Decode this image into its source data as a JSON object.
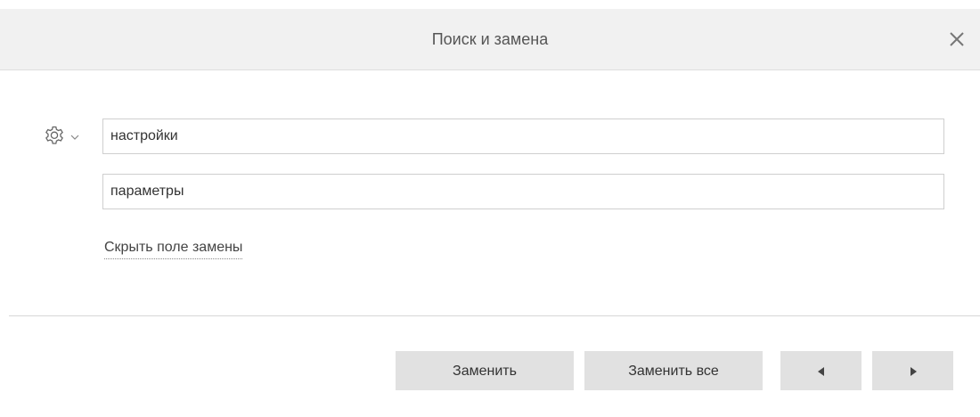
{
  "dialog": {
    "title": "Поиск и замена",
    "close_icon": "close-icon",
    "settings_icon": "gear-icon"
  },
  "find": {
    "value": "настройки"
  },
  "replace": {
    "value": "параметры"
  },
  "toggle_link": "Скрыть поле замены",
  "buttons": {
    "replace": "Заменить",
    "replace_all": "Заменить все",
    "prev_icon": "triangle-left-icon",
    "next_icon": "triangle-right-icon"
  },
  "colors": {
    "titlebar_bg": "#f1f1f1",
    "button_bg": "#e1e1e1"
  }
}
